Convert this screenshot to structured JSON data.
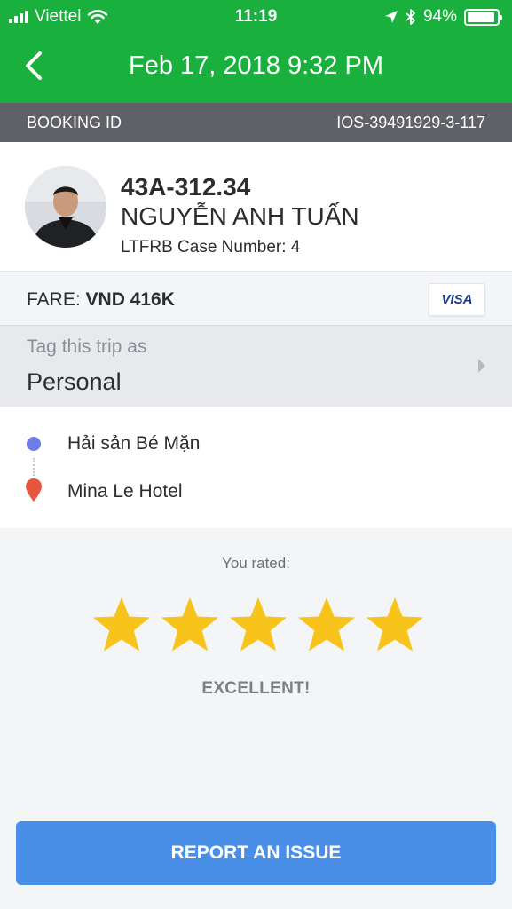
{
  "status_bar": {
    "carrier": "Viettel",
    "time": "11:19",
    "battery_text": "94%",
    "battery_level": 0.94
  },
  "nav": {
    "title": "Feb 17, 2018 9:32 PM",
    "back_icon": "chevron-left-icon"
  },
  "booking": {
    "label": "BOOKING ID",
    "value": "IOS-39491929-3-117"
  },
  "driver": {
    "plate": "43A-312.34",
    "name": "NGUYỄN ANH TUẤN",
    "ltfrb": "LTFRB Case Number: 4"
  },
  "fare": {
    "label": "FARE:",
    "value": "VND 416K",
    "card_brand": "VISA"
  },
  "tag": {
    "label": "Tag this trip as",
    "value": "Personal"
  },
  "route": {
    "pickup": "Hải sản Bé Mặn",
    "dropoff": "Mina Le Hotel",
    "pickup_color": "#6f7de8",
    "dropoff_color": "#e8553f"
  },
  "rating": {
    "label": "You rated:",
    "stars": 5,
    "max_stars": 5,
    "verdict": "EXCELLENT!",
    "star_color": "#f8c31b"
  },
  "actions": {
    "report": "REPORT AN ISSUE"
  },
  "colors": {
    "brand_green": "#19b03d",
    "button_blue": "#4a8fe7"
  }
}
